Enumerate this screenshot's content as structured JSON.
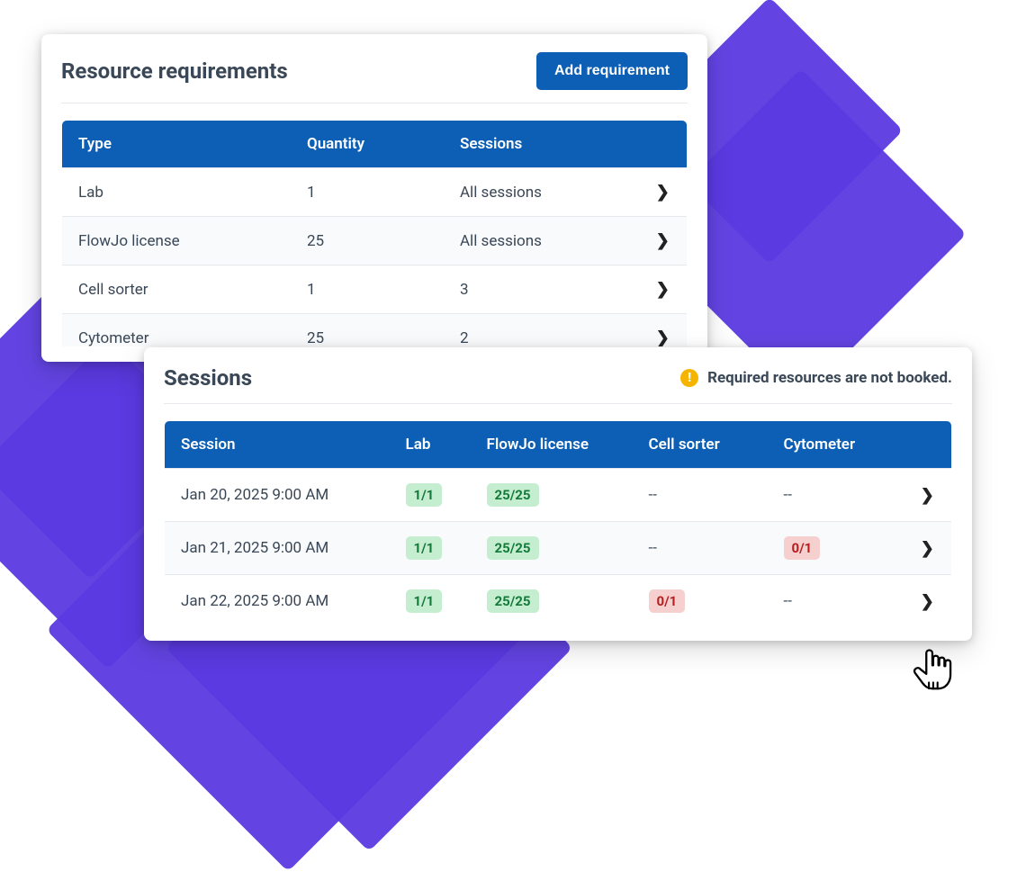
{
  "requirements": {
    "title": "Resource requirements",
    "add_button": "Add requirement",
    "columns": {
      "type": "Type",
      "quantity": "Quantity",
      "sessions": "Sessions"
    },
    "rows": [
      {
        "type": "Lab",
        "quantity": "1",
        "sessions": "All sessions"
      },
      {
        "type": "FlowJo license",
        "quantity": "25",
        "sessions": "All sessions"
      },
      {
        "type": "Cell sorter",
        "quantity": "1",
        "sessions": "3"
      },
      {
        "type": "Cytometer",
        "quantity": "25",
        "sessions": "2"
      }
    ]
  },
  "sessions": {
    "title": "Sessions",
    "warning": "Required resources are not booked.",
    "columns": {
      "session": "Session",
      "lab": "Lab",
      "flowjo": "FlowJo license",
      "cell_sorter": "Cell sorter",
      "cytometer": "Cytometer"
    },
    "empty": "--",
    "rows": [
      {
        "session": "Jan 20, 2025 9:00 AM",
        "lab": {
          "text": "1/1",
          "status": "ok"
        },
        "flowjo": {
          "text": "25/25",
          "status": "ok"
        },
        "cell_sorter": null,
        "cytometer": null
      },
      {
        "session": "Jan 21, 2025 9:00 AM",
        "lab": {
          "text": "1/1",
          "status": "ok"
        },
        "flowjo": {
          "text": "25/25",
          "status": "ok"
        },
        "cell_sorter": null,
        "cytometer": {
          "text": "0/1",
          "status": "bad"
        }
      },
      {
        "session": "Jan 22, 2025 9:00 AM",
        "lab": {
          "text": "1/1",
          "status": "ok"
        },
        "flowjo": {
          "text": "25/25",
          "status": "ok"
        },
        "cell_sorter": {
          "text": "0/1",
          "status": "bad"
        },
        "cytometer": null
      }
    ]
  },
  "colors": {
    "accent": "#5b3ae0",
    "primary": "#0c5fb4",
    "ok_bg": "#c5edd0",
    "ok_fg": "#137a3a",
    "bad_bg": "#f6cfcf",
    "bad_fg": "#b71f1f",
    "warn": "#f4b400"
  }
}
